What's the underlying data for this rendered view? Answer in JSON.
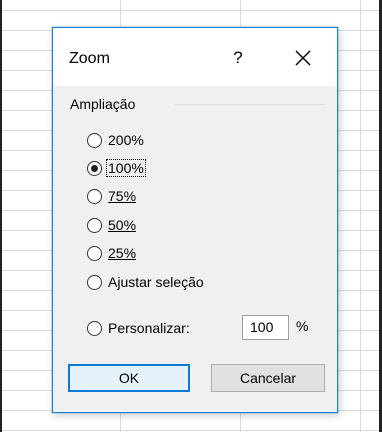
{
  "dialog": {
    "title": "Zoom",
    "help_label": "?",
    "close_icon": "close-icon"
  },
  "group": {
    "title": "Ampliação"
  },
  "options": [
    {
      "label": "200%",
      "checked": false
    },
    {
      "label": "100%",
      "checked": true
    },
    {
      "label": "75%",
      "checked": false
    },
    {
      "label": "50%",
      "checked": false
    },
    {
      "label": "25%",
      "checked": false
    },
    {
      "label": "Ajustar seleção",
      "checked": false
    },
    {
      "label": "Personalizar:",
      "checked": false
    }
  ],
  "custom": {
    "value": "100",
    "unit": "%"
  },
  "buttons": {
    "ok": "OK",
    "cancel": "Cancelar"
  },
  "colors": {
    "accent": "#0a78d7",
    "dialog_bg": "#f0f0f0"
  }
}
